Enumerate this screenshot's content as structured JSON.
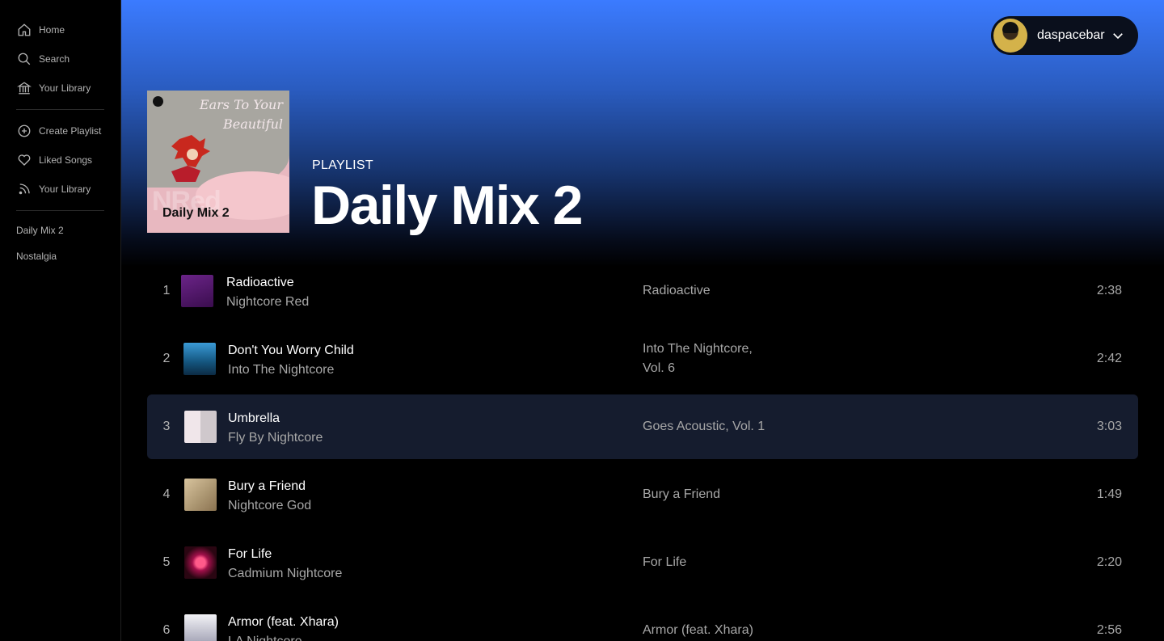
{
  "sidebar": {
    "nav": [
      {
        "label": "Home",
        "icon": "home-icon"
      },
      {
        "label": "Search",
        "icon": "search-icon"
      },
      {
        "label": "Your Library",
        "icon": "library-icon"
      }
    ],
    "actions": [
      {
        "label": "Create Playlist",
        "icon": "plus-circle-icon"
      },
      {
        "label": "Liked Songs",
        "icon": "heart-icon"
      },
      {
        "label": "Your Library",
        "icon": "rss-icon"
      }
    ],
    "playlists": [
      "Daily Mix 2",
      "Nostalgia"
    ]
  },
  "user": {
    "name": "daspacebar",
    "icon": "chevron-down-icon"
  },
  "playlist": {
    "kind": "PLAYLIST",
    "title": "Daily Mix 2",
    "cover": {
      "script_text": "Ears To Your Beautiful",
      "tag": "Daily Mix 2",
      "faded_text": "NRed"
    }
  },
  "tracks": [
    {
      "num": "1",
      "song": "Radioactive",
      "artist": "Nightcore Red",
      "album": "Radioactive",
      "duration": "2:38",
      "thumb_color": "#5a1e6e"
    },
    {
      "num": "2",
      "song": "Don't You Worry Child",
      "artist": "Into The Nightcore",
      "album": "Into The Nightcore, Vol. 6",
      "duration": "2:42",
      "thumb_color": "#1b6a9a"
    },
    {
      "num": "3",
      "song": "Umbrella",
      "artist": "Fly By Nightcore",
      "album": "Goes Acoustic, Vol. 1",
      "duration": "3:03",
      "thumb_color": "#d9d4d6",
      "active": true
    },
    {
      "num": "4",
      "song": "Bury a Friend",
      "artist": "Nightcore God",
      "album": "Bury a Friend",
      "duration": "1:49",
      "thumb_color": "#b8a07a"
    },
    {
      "num": "5",
      "song": "For Life",
      "artist": "Cadmium Nightcore",
      "album": "For Life",
      "duration": "2:20",
      "thumb_color": "#8a1a4a"
    },
    {
      "num": "6",
      "song": "Armor (feat. Xhara)",
      "artist": "LA Nightcore",
      "album": "Armor (feat. Xhara)",
      "duration": "2:56",
      "thumb_color": "#cfcfd6"
    }
  ]
}
